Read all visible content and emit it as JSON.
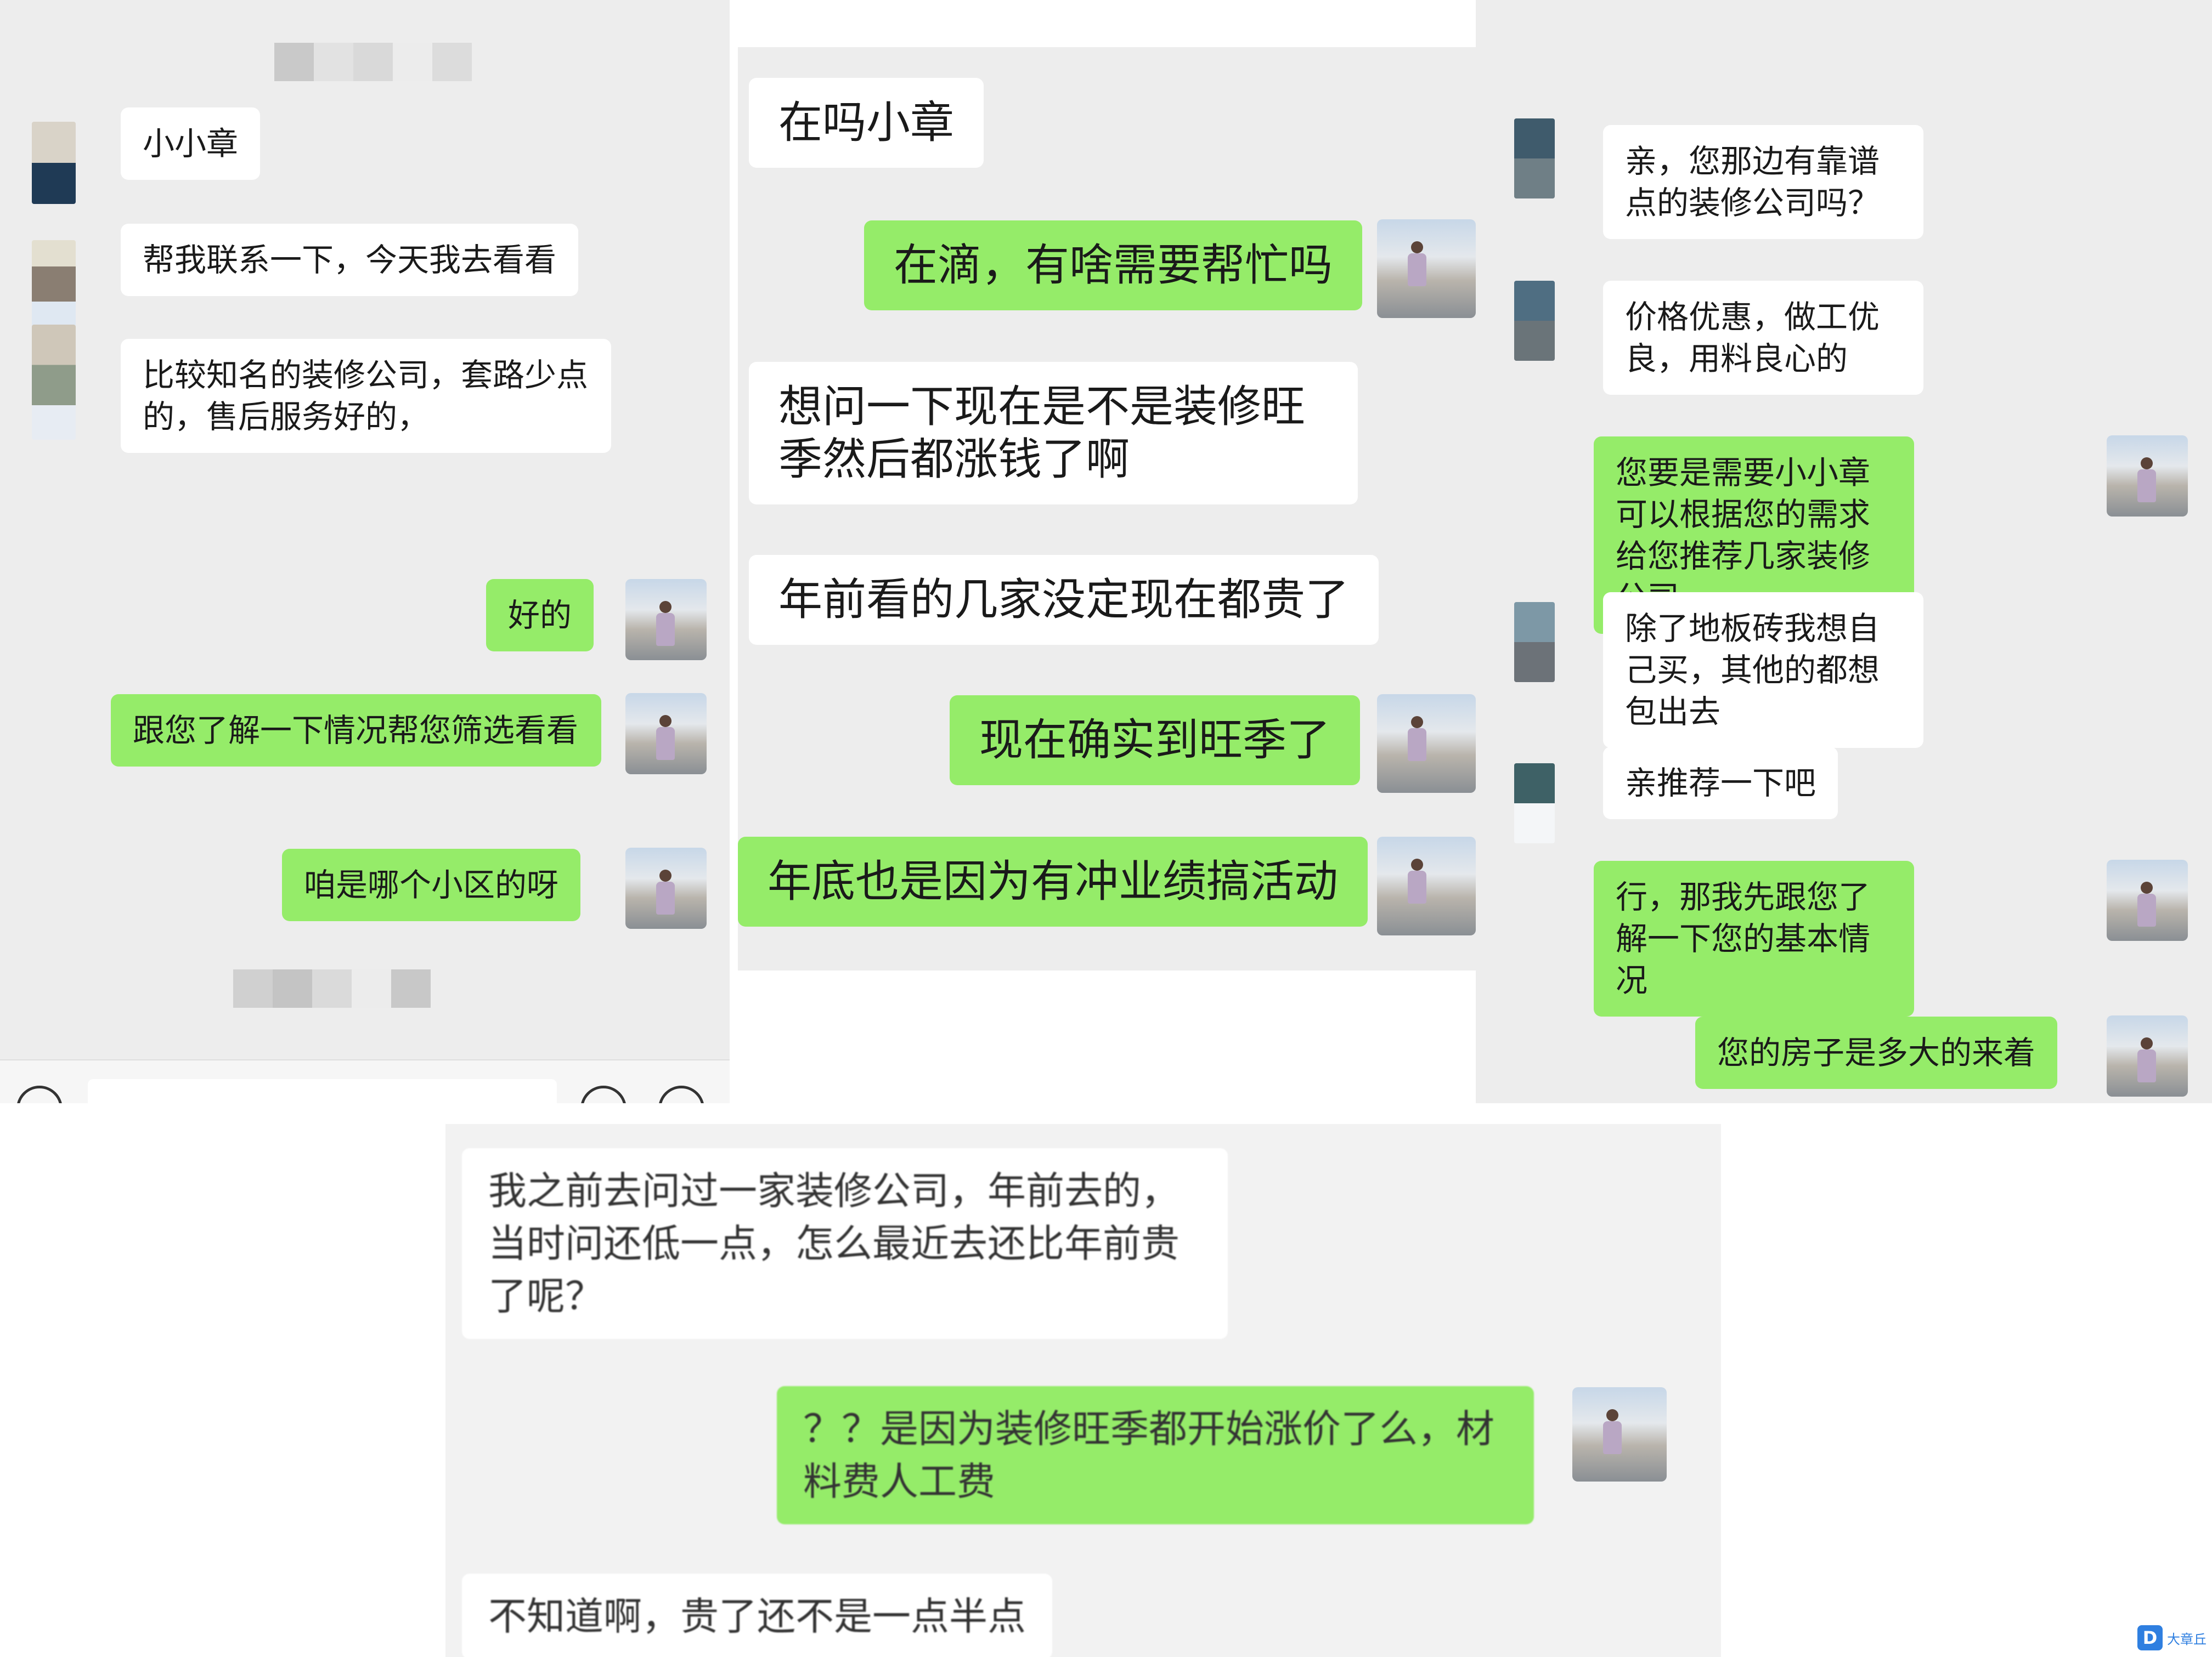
{
  "panel1": {
    "messages": [
      {
        "text": "小小章",
        "sender": "them"
      },
      {
        "text": "帮我联系一下，今天我去看看",
        "sender": "them"
      },
      {
        "text": "比较知名的装修公司，套路少点的，售后服务好的，",
        "sender": "them"
      },
      {
        "text": "好的",
        "sender": "me"
      },
      {
        "text": "跟您了解一下情况帮您筛选看看",
        "sender": "me"
      },
      {
        "text": "咱是哪个小区的呀",
        "sender": "me"
      }
    ]
  },
  "panel2": {
    "messages": [
      {
        "text": "在吗小章",
        "sender": "them"
      },
      {
        "text": "在滴，有啥需要帮忙吗",
        "sender": "me"
      },
      {
        "text": "想问一下现在是不是装修旺季然后都涨钱了啊",
        "sender": "them"
      },
      {
        "text": "年前看的几家没定现在都贵了",
        "sender": "them"
      },
      {
        "text": "现在确实到旺季了",
        "sender": "me"
      },
      {
        "text": "年底也是因为有冲业绩搞活动",
        "sender": "me"
      }
    ]
  },
  "panel3": {
    "messages": [
      {
        "text": "亲，您那边有靠谱点的装修公司吗？",
        "sender": "them"
      },
      {
        "text": "价格优惠，做工优良，用料良心的",
        "sender": "them"
      },
      {
        "text": "您要是需要小小章可以根据您的需求给您推荐几家装修公司",
        "sender": "me"
      },
      {
        "text": "除了地板砖我想自己买，其他的都想包出去",
        "sender": "them"
      },
      {
        "text": "亲推荐一下吧",
        "sender": "them"
      },
      {
        "text": "行，那我先跟您了解一下您的基本情况",
        "sender": "me"
      },
      {
        "text": "您的房子是多大的来着",
        "sender": "me"
      }
    ]
  },
  "panel4": {
    "messages": [
      {
        "text": "我之前去问过一家装修公司，年前去的，当时问还低一点，怎么最近去还比年前贵了呢？",
        "sender": "them"
      },
      {
        "text": "？？是因为装修旺季都开始涨价了么，材料费人工费",
        "sender": "me"
      },
      {
        "text": "不知道啊，贵了还不是一点半点",
        "sender": "them"
      }
    ]
  },
  "watermark": {
    "text": "大章丘",
    "logo_letter": "D"
  },
  "colors": {
    "my_bubble": "#95ec69",
    "their_bubble": "#ffffff",
    "chat_bg": "#ededed"
  }
}
